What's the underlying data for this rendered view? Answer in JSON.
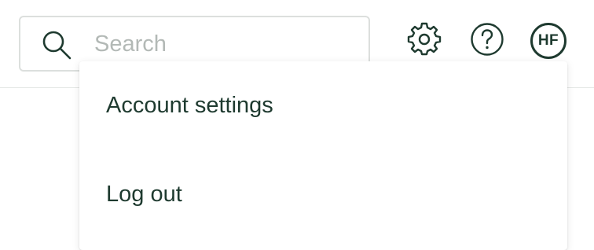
{
  "search": {
    "placeholder": "Search",
    "value": ""
  },
  "header": {
    "icons": [
      "search-icon",
      "gear-icon",
      "help-icon"
    ],
    "avatar_initials": "HF"
  },
  "menu": {
    "items": [
      {
        "label": "Account settings"
      },
      {
        "label": "Log out"
      }
    ]
  },
  "colors": {
    "text": "#1e3a2f",
    "placeholder": "#b3b9b6",
    "border": "#dcdfdd"
  }
}
